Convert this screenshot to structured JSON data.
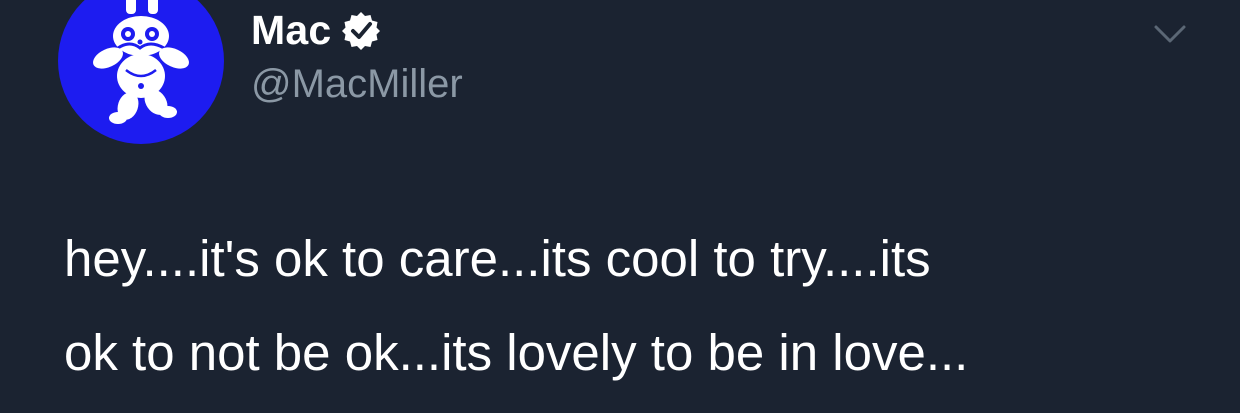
{
  "author": {
    "display_name": "Mac",
    "handle": "@MacMiller",
    "verified": true,
    "avatar_icon": "robot-mascot-icon",
    "avatar_bg_color": "#1d1cf0"
  },
  "tweet": {
    "lines": [
      "hey....it's ok to care...its cool to try....its",
      "ok to not be ok...its lovely to be in love..."
    ]
  },
  "menu": {
    "icon": "chevron-down-icon"
  },
  "colors": {
    "background": "#1b2331",
    "text": "#ffffff",
    "handle": "#8b98a5"
  }
}
